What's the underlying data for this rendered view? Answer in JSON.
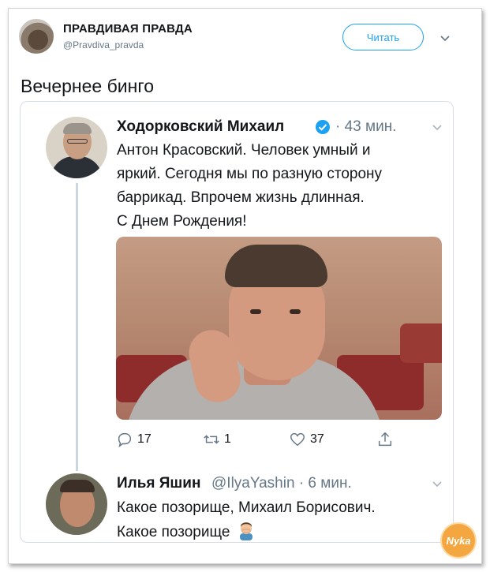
{
  "header": {
    "account_name": "ПРАВДИВАЯ ПРАВДА",
    "handle": "@Pravdiva_pravda",
    "follow_label": "Читать",
    "menu_icon": "chevron-down-icon"
  },
  "tweet": {
    "text": "Вечернее бинго"
  },
  "quoted": {
    "author": "Ходорковский Михаил",
    "verified_icon": "verified-badge-icon",
    "time": "· 43 мин.",
    "lines": [
      "Антон Красовский. Человек умный и",
      "яркий. Сегодня мы по разную сторону",
      "баррикад. Впрочем жизнь длинная.",
      "С Днем Рождения!"
    ],
    "actions": {
      "replies": "17",
      "retweets": "1",
      "likes": "37"
    }
  },
  "reply": {
    "author": "Илья Яшин",
    "handle_time": "@IlyaYashin · 6 мин.",
    "lines": [
      "Какое позорище, Михаил Борисович.",
      "Какое позорище"
    ]
  },
  "watermark": {
    "text": "Nyka"
  },
  "colors": {
    "accent": "#1da1f2",
    "muted": "#657786",
    "border": "#d7dde2"
  }
}
